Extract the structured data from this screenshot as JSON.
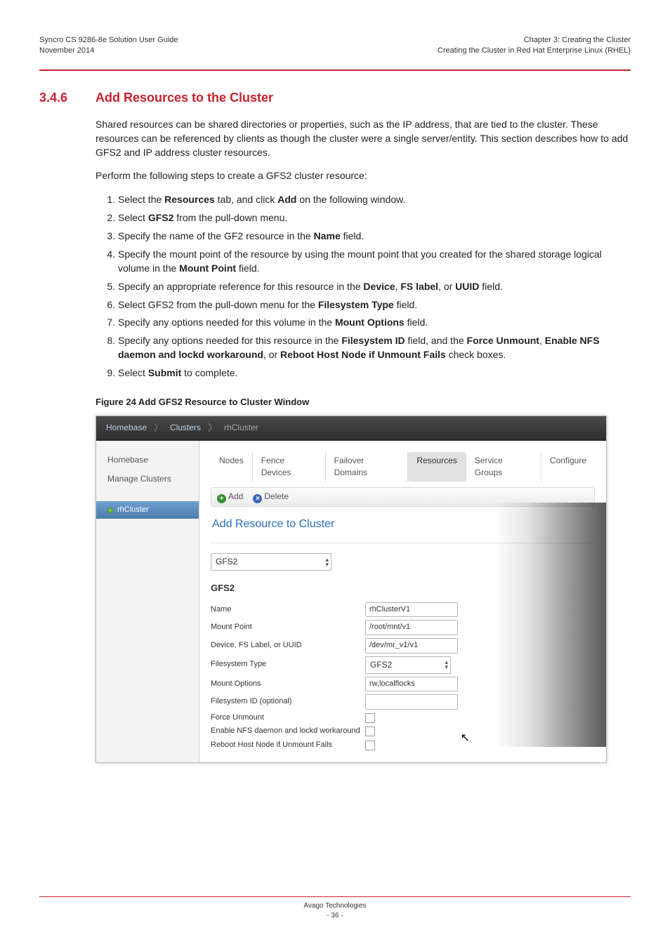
{
  "header": {
    "left1": "Syncro CS 9286-8e Solution User Guide",
    "left2": "November 2014",
    "right1": "Chapter 3: Creating the Cluster",
    "right2": "Creating the Cluster in Red Hat Enterprise Linux (RHEL)"
  },
  "section": {
    "num": "3.4.6",
    "title": "Add Resources to the Cluster",
    "para1": "Shared resources can be shared directories or properties, such as the IP address, that are tied to the cluster. These resources can be referenced by clients as though the cluster were a single server/entity. This section describes how to add GFS2 and IP address cluster resources.",
    "para2": "Perform the following steps to create a GFS2 cluster resource:",
    "steps": [
      {
        "pre": "Select the ",
        "b1": "Resources",
        "mid": " tab, and click ",
        "b2": "Add",
        "post": " on the following window."
      },
      {
        "pre": "Select ",
        "b1": "GFS2",
        "post": " from the pull-down menu."
      },
      {
        "pre": "Specify the name of the GF2 resource in the ",
        "b1": "Name",
        "post": " field."
      },
      {
        "pre": "Specify the mount point of the resource by using the mount point that you created for the shared storage logical volume in the ",
        "b1": "Mount Point",
        "post": " field."
      },
      {
        "pre": "Specify an appropriate reference for this resource in the ",
        "b1": "Device",
        "mid": ", ",
        "b2": "FS label",
        "mid2": ", or ",
        "b3": "UUID",
        "post": " field."
      },
      {
        "pre": "Select GFS2 from the pull-down menu for the ",
        "b1": "Filesystem Type",
        "post": " field."
      },
      {
        "pre": "Specify any options needed for this volume in the ",
        "b1": "Mount Options",
        "post": " field."
      },
      {
        "pre": "Specify any options needed for this resource in the ",
        "b1": "Filesystem ID",
        "mid": " field, and the ",
        "b2": "Force Unmount",
        "mid2": ", ",
        "b3": "Enable NFS daemon and lockd workaround",
        "mid3": ", or ",
        "b4": "Reboot Host Node if Unmount Fails",
        "post": " check boxes."
      },
      {
        "pre": "Select ",
        "b1": "Submit",
        "post": " to complete."
      }
    ],
    "fig_cap": "Figure 24  Add GFS2 Resource to Cluster Window"
  },
  "shot": {
    "crumbs": [
      "Homebase",
      "Clusters",
      "rhCluster"
    ],
    "side": {
      "links": [
        "Homebase",
        "Manage Clusters"
      ],
      "selected": "rhCluster"
    },
    "tabs": [
      "Nodes",
      "Fence Devices",
      "Failover Domains",
      "Resources",
      "Service Groups",
      "Configure"
    ],
    "toolbar": {
      "add": "Add",
      "del": "Delete"
    },
    "panel_title": "Add Resource to Cluster",
    "type_select": "GFS2",
    "type_heading": "GFS2",
    "fields": [
      {
        "label": "Name",
        "value": "rhClusterV1",
        "kind": "text"
      },
      {
        "label": "Mount Point",
        "value": "/root/mnt/v1",
        "kind": "text"
      },
      {
        "label": "Device, FS Label, or UUID",
        "value": "/dev/mr_v1/v1",
        "kind": "text"
      },
      {
        "label": "Filesystem Type",
        "value": "GFS2",
        "kind": "select"
      },
      {
        "label": "Mount Options",
        "value": "rw,localflocks",
        "kind": "text"
      },
      {
        "label": "Filesystem ID (optional)",
        "value": "",
        "kind": "text"
      },
      {
        "label": "Force Unmount",
        "value": "",
        "kind": "checkbox"
      },
      {
        "label": "Enable NFS daemon and lockd workaround",
        "value": "",
        "kind": "checkbox"
      },
      {
        "label": "Reboot Host Node if Unmount Fails",
        "value": "",
        "kind": "checkbox"
      }
    ]
  },
  "footer": {
    "line1": "Avago Technologies",
    "line2": "- 36 -"
  }
}
